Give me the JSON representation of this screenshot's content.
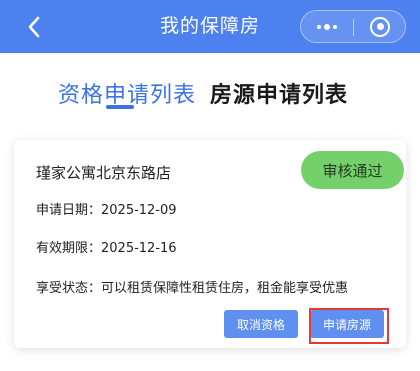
{
  "navbar": {
    "title": "我的保障房",
    "back_icon": "chevron-left-icon",
    "more_icon": "more-dots-icon",
    "close_icon": "target-circle-icon",
    "background": "#4d81ef"
  },
  "tabs": [
    {
      "label": "资格申请列表",
      "active": true
    },
    {
      "label": "房源申请列表",
      "active": false
    }
  ],
  "card": {
    "shop_name": "瑾家公寓北京东路店",
    "status_badge": "审核通过",
    "apply_date": "申请日期：2025-12-09",
    "valid_until": "有效期限：2025-12-16",
    "enjoy_status": "享受状态：可以租赁保障性租赁住房，租金能享受优惠",
    "cancel_button": "取消资格",
    "apply_button": "申请房源"
  },
  "colors": {
    "accent": "#3a72e8",
    "badge_green": "#74d06a",
    "button_blue": "#5f8ff0",
    "highlight_red": "#e53935"
  }
}
